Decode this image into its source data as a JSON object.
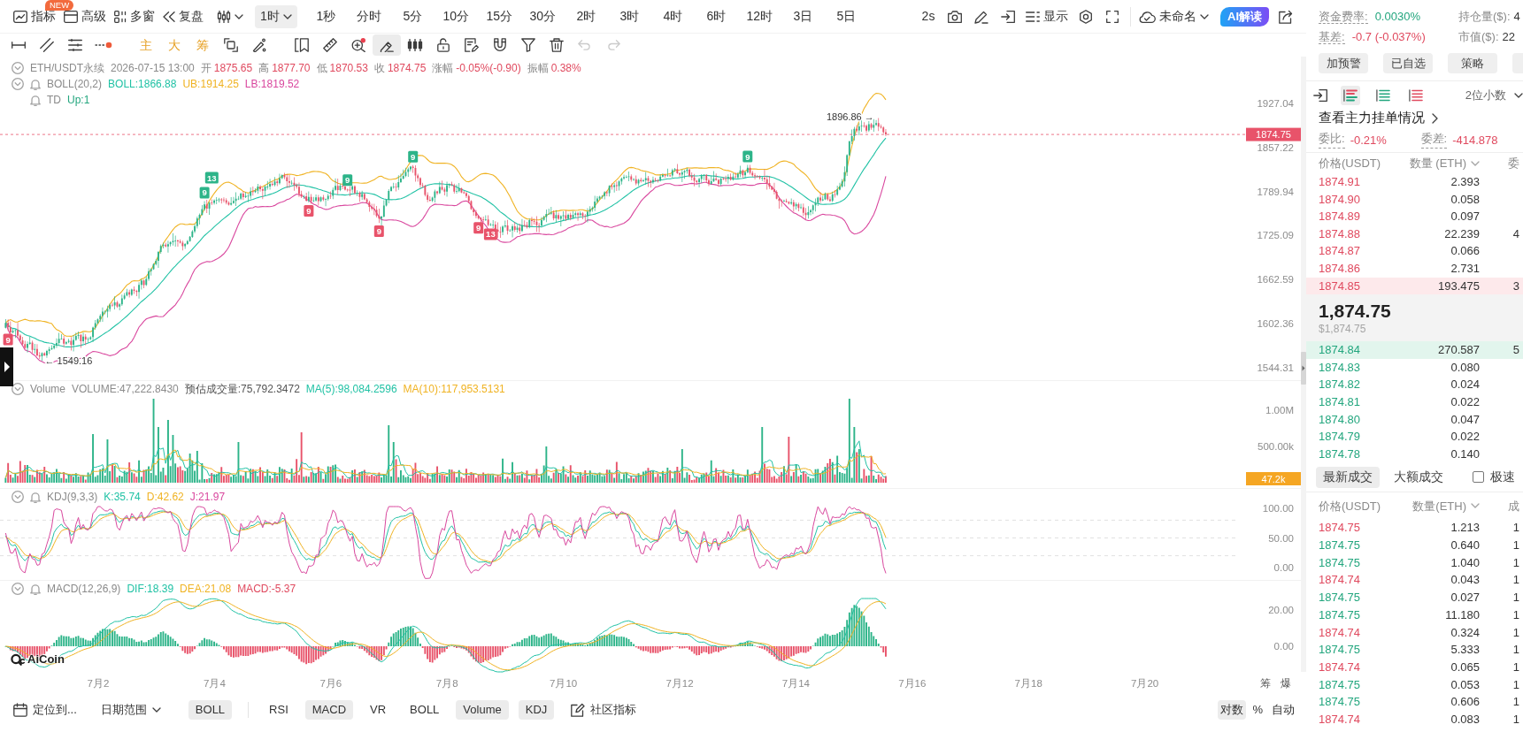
{
  "top_toolbar": {
    "menu": [
      {
        "label": "指标",
        "badge": "NEW"
      },
      {
        "label": "高级"
      },
      {
        "label": "多窗"
      },
      {
        "label": "复盘"
      }
    ],
    "interval_select": "1时",
    "intervals": [
      "1秒",
      "分时",
      "5分",
      "10分",
      "15分",
      "30分",
      "2时",
      "3时",
      "4时",
      "6时",
      "12时",
      "3日",
      "5日"
    ],
    "refresh_rate": "2s",
    "display_button": "显示",
    "layout_name": "未命名",
    "ai_button": "AI解读"
  },
  "drawing_toolbar": {
    "line_tools": [
      {
        "selected": false
      },
      {
        "selected": false
      },
      {
        "selected": false
      },
      {
        "selected": false
      }
    ],
    "overlay_toggles": [
      "主",
      "大",
      "筹"
    ],
    "tools": [
      {
        "selected": false
      },
      {
        "selected": false
      },
      {
        "selected": false
      },
      {
        "selected": false
      },
      {
        "selected": false
      },
      {
        "selected": true
      },
      {
        "selected": false
      },
      {
        "selected": false
      },
      {
        "selected": false
      },
      {
        "selected": false
      },
      {
        "selected": false
      },
      {
        "selected": false
      }
    ],
    "history": [
      {
        "disabled": true
      },
      {
        "disabled": true
      }
    ]
  },
  "main_chart": {
    "legend": {
      "symbol": "ETH/USDT永续",
      "time": "2026-07-15 13:00",
      "fields": [
        {
          "label": "开",
          "value": "1875.65"
        },
        {
          "label": "高",
          "value": "1877.70"
        },
        {
          "label": "低",
          "value": "1870.53"
        },
        {
          "label": "收",
          "value": "1874.75"
        },
        {
          "label": "涨幅",
          "value": "-0.05%(-0.90)"
        },
        {
          "label": "振幅",
          "value": "0.38%"
        }
      ]
    },
    "indicators": [
      {
        "name": "BOLL(20,2)",
        "collapse_toggle": true,
        "alert_bell": true,
        "values": [
          {
            "text": "BOLL:1866.88",
            "color": "#21c2a5"
          },
          {
            "text": "UB:1914.25",
            "color": "#f0b323"
          },
          {
            "text": "LB:1819.52",
            "color": "#d9479e"
          }
        ]
      },
      {
        "name": "TD",
        "collapse_toggle": false,
        "alert_bell": true,
        "values": [
          {
            "text": "Up:1",
            "color": "#23a67e"
          }
        ]
      }
    ],
    "high_label": "1896.86 →",
    "low_label": "← 1549.16",
    "td_markers": [
      {
        "text": "9",
        "kind": "bottom"
      },
      {
        "text": "9",
        "kind": "top"
      },
      {
        "text": "13",
        "kind": "top"
      },
      {
        "text": "9",
        "kind": "bottom"
      },
      {
        "text": "9",
        "kind": "top"
      },
      {
        "text": "9",
        "kind": "bottom"
      },
      {
        "text": "9",
        "kind": "top"
      },
      {
        "text": "9",
        "kind": "bottom"
      },
      {
        "text": "13",
        "kind": "bottom"
      },
      {
        "text": "9",
        "kind": "top"
      }
    ],
    "current_price_tag": "1874.75",
    "price_axis": [
      "1927.04",
      "1857.22",
      "1789.94",
      "1725.09",
      "1662.59",
      "1602.36",
      "1544.31"
    ]
  },
  "volume_panel": {
    "name": "Volume",
    "collapse_toggle": true,
    "alert_bell": false,
    "values": [
      {
        "text": "VOLUME:47,222.8430",
        "color": "#8c8c8c"
      },
      {
        "text": "预估成交量:75,792.3472",
        "color": "#555555"
      },
      {
        "text": "MA(5):98,084.2596",
        "color": "#21c2a5"
      },
      {
        "text": "MA(10):117,953.5131",
        "color": "#f0b323"
      }
    ],
    "axis": [
      "1.00M",
      "500.00k"
    ],
    "last_volume_tag": "47.2k"
  },
  "kdj_panel": {
    "name": "KDJ(9,3,3)",
    "collapse_toggle": true,
    "alert_bell": true,
    "values": [
      {
        "text": "K:35.74",
        "color": "#21c2a5"
      },
      {
        "text": "D:42.62",
        "color": "#f0b323"
      },
      {
        "text": "J:21.97",
        "color": "#d9479e"
      }
    ],
    "axis": [
      "100.00",
      "50.00",
      "0.00"
    ]
  },
  "macd_panel": {
    "name": "MACD(12,26,9)",
    "collapse_toggle": true,
    "alert_bell": true,
    "values": [
      {
        "text": "DIF:18.39",
        "color": "#21c2a5"
      },
      {
        "text": "DEA:21.08",
        "color": "#f0b323"
      },
      {
        "text": "MACD:-5.37",
        "color": "#e04a5f"
      }
    ],
    "axis": [
      "20.00",
      "0.00"
    ]
  },
  "chart_logo": "AiCoin",
  "date_axis": [
    "7月2",
    "7月4",
    "7月6",
    "7月8",
    "7月10",
    "7月12",
    "7月14",
    "7月16",
    "7月18",
    "7月20"
  ],
  "axis_buttons": [
    "筹",
    "爆"
  ],
  "bottom_toolbar": {
    "locate": "定位到...",
    "date_range": "日期范围",
    "main_indicators": [
      {
        "label": "BOLL",
        "selected": true
      }
    ],
    "sub_indicators": [
      {
        "label": "RSI",
        "selected": false
      },
      {
        "label": "MACD",
        "selected": true
      },
      {
        "label": "VR",
        "selected": false
      },
      {
        "label": "BOLL",
        "selected": false
      },
      {
        "label": "Volume",
        "selected": true
      },
      {
        "label": "KDJ",
        "selected": true
      }
    ],
    "community": "社区指标",
    "scale_options": [
      {
        "label": "对数",
        "selected": true
      },
      {
        "label": "%",
        "selected": false
      },
      {
        "label": "自动",
        "selected": false
      }
    ]
  },
  "market_stats": [
    {
      "label": "资金费率:",
      "value": "0.0030%",
      "color": "#23a67e",
      "has_tooltip": true
    },
    {
      "label": "持仓量($):",
      "value": "4",
      "color": "#333333",
      "has_tooltip": false
    },
    {
      "label": "基差:",
      "value": "-0.7 (-0.037%)",
      "color": "#e04a5f",
      "has_tooltip": true
    },
    {
      "label": "市值($):",
      "value": "22",
      "color": "#333333",
      "has_tooltip": false
    }
  ],
  "action_buttons": [
    {
      "kind": "full",
      "label": "加预警"
    },
    {
      "kind": "full",
      "label": "已自选"
    },
    {
      "kind": "full",
      "label": "策略"
    },
    {
      "kind": "partial"
    }
  ],
  "order_book": {
    "view_modes": [
      {
        "selected": true
      },
      {
        "selected": false
      },
      {
        "selected": false
      }
    ],
    "precision": "2位小数",
    "main_orders_link": "查看主力挂单情况",
    "ratio": {
      "label": "委比:",
      "value": "-0.21%"
    },
    "difference": {
      "label": "委差:",
      "value": "-414.878"
    },
    "columns": [
      "价格(USDT)",
      "数量 (ETH)",
      "委"
    ],
    "asks": [
      {
        "price": "1874.91",
        "amount": "2.393",
        "highlighted": false
      },
      {
        "price": "1874.90",
        "amount": "0.058",
        "highlighted": false
      },
      {
        "price": "1874.89",
        "amount": "0.097",
        "highlighted": false
      },
      {
        "price": "1874.88",
        "amount": "22.239",
        "column_3": "4",
        "highlighted": false
      },
      {
        "price": "1874.87",
        "amount": "0.066",
        "highlighted": false
      },
      {
        "price": "1874.86",
        "amount": "2.731",
        "highlighted": false
      },
      {
        "price": "1874.85",
        "amount": "193.475",
        "column_3": "3",
        "highlighted": true
      }
    ],
    "last_price": "1,874.75",
    "last_price_usd": "$1,874.75",
    "bids": [
      {
        "price": "1874.84",
        "amount": "270.587",
        "column_3": "5",
        "highlighted": true
      },
      {
        "price": "1874.83",
        "amount": "0.080",
        "highlighted": false
      },
      {
        "price": "1874.82",
        "amount": "0.024",
        "highlighted": false
      },
      {
        "price": "1874.81",
        "amount": "0.022",
        "highlighted": false
      },
      {
        "price": "1874.80",
        "amount": "0.047",
        "highlighted": false
      },
      {
        "price": "1874.79",
        "amount": "0.022",
        "highlighted": false
      },
      {
        "price": "1874.78",
        "amount": "0.140",
        "highlighted": false
      }
    ]
  },
  "trades": {
    "tabs": [
      {
        "label": "最新成交",
        "selected": true
      },
      {
        "label": "大额成交",
        "selected": false
      }
    ],
    "fast_mode": {
      "label": "极速",
      "checked": false
    },
    "columns": [
      "价格(USDT)",
      "数量(ETH)",
      "成"
    ],
    "rows": [
      {
        "price": "1874.75",
        "amount": "1.213",
        "color": "#e04a5f",
        "column_3": "1"
      },
      {
        "price": "1874.75",
        "amount": "0.640",
        "color": "#23a67e",
        "column_3": "1"
      },
      {
        "price": "1874.75",
        "amount": "1.040",
        "color": "#23a67e",
        "column_3": "1"
      },
      {
        "price": "1874.74",
        "amount": "0.043",
        "color": "#e04a5f",
        "column_3": "1"
      },
      {
        "price": "1874.75",
        "amount": "0.027",
        "color": "#23a67e",
        "column_3": "1"
      },
      {
        "price": "1874.75",
        "amount": "11.180",
        "color": "#23a67e",
        "column_3": "1"
      },
      {
        "price": "1874.74",
        "amount": "0.324",
        "color": "#e04a5f",
        "column_3": "1"
      },
      {
        "price": "1874.75",
        "amount": "5.333",
        "color": "#23a67e",
        "column_3": "1"
      },
      {
        "price": "1874.74",
        "amount": "0.065",
        "color": "#e04a5f",
        "column_3": "1"
      },
      {
        "price": "1874.75",
        "amount": "0.053",
        "color": "#23a67e",
        "column_3": "1"
      },
      {
        "price": "1874.75",
        "amount": "0.606",
        "color": "#23a67e",
        "column_3": "1"
      },
      {
        "price": "1874.74",
        "amount": "0.083",
        "color": "#e04a5f",
        "column_3": "1"
      }
    ]
  }
}
